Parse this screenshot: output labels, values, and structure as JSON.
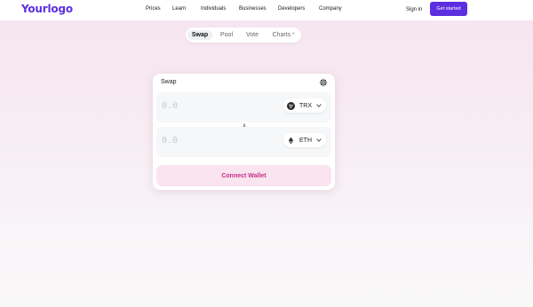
{
  "header": {
    "logo": "Yourlogo",
    "nav": [
      "Prices",
      "Learn",
      "Individuals",
      "Businesses",
      "Developers",
      "Company"
    ],
    "signin": "Sign in",
    "cta": "Get started"
  },
  "tabs": [
    {
      "label": "Swap",
      "active": true
    },
    {
      "label": "Pool",
      "active": false
    },
    {
      "label": "Vote",
      "active": false
    },
    {
      "label": "Charts",
      "active": false,
      "external_icon": "↗"
    }
  ],
  "swap_card": {
    "title": "Swap",
    "settings_icon": "gear-icon",
    "input": {
      "amount_placeholder": "0.0",
      "token": "TRX"
    },
    "arrow_icon": "arrow-down-icon",
    "output": {
      "amount_placeholder": "0.0",
      "token": "ETH"
    },
    "connect_label": "Connect Wallet"
  },
  "colors": {
    "brand": "#5b2ee0",
    "connect_text": "#c52f8a",
    "connect_bg": "#f9e4ef"
  }
}
